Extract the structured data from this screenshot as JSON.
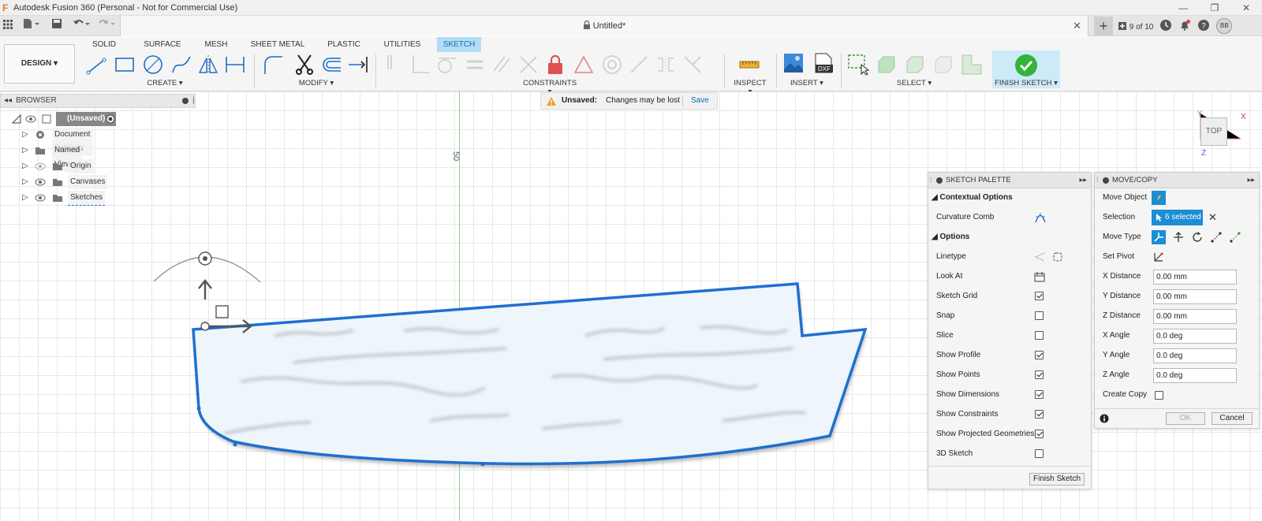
{
  "window": {
    "title": "Autodesk Fusion 360 (Personal - Not for Commercial Use)",
    "minimize": "—",
    "restore": "❐",
    "close": "✕"
  },
  "tabbar": {
    "doc_title": "Untitled*",
    "job_count": "9 of 10",
    "user_initials": "BB"
  },
  "workspace_tabs": [
    "SOLID",
    "SURFACE",
    "MESH",
    "SHEET METAL",
    "PLASTIC",
    "UTILITIES",
    "SKETCH"
  ],
  "active_workspace_tab": "SKETCH",
  "design_button": "DESIGN ▾",
  "ribbon_groups": {
    "create": "CREATE ▾",
    "modify": "MODIFY ▾",
    "constraints": "CONSTRAINTS ▾",
    "inspect": "INSPECT ▾",
    "insert": "INSERT ▾",
    "select": "SELECT ▾",
    "finish_sketch": "FINISH SKETCH ▾"
  },
  "browser": {
    "header": "BROWSER",
    "root": "(Unsaved)",
    "items": [
      "Document Settings",
      "Named Views",
      "Origin",
      "Canvases",
      "Sketches"
    ]
  },
  "notification": {
    "label": "Unsaved:",
    "message": "Changes may be lost",
    "action": "Save"
  },
  "canvas": {
    "axis_label": "50",
    "viewcube_label": "TOP",
    "axis_x": "X",
    "axis_y": "Y",
    "axis_z": "Z"
  },
  "sketch_palette": {
    "title": "SKETCH PALETTE",
    "section_contextual": "Contextual Options",
    "curvature_comb": "Curvature Comb",
    "section_options": "Options",
    "rows": [
      {
        "label": "Linetype",
        "type": "icons"
      },
      {
        "label": "Look At",
        "type": "icon"
      },
      {
        "label": "Sketch Grid",
        "checked": true
      },
      {
        "label": "Snap",
        "checked": false
      },
      {
        "label": "Slice",
        "checked": false
      },
      {
        "label": "Show Profile",
        "checked": true
      },
      {
        "label": "Show Points",
        "checked": true
      },
      {
        "label": "Show Dimensions",
        "checked": true
      },
      {
        "label": "Show Constraints",
        "checked": true
      },
      {
        "label": "Show Projected Geometries",
        "checked": true
      },
      {
        "label": "3D Sketch",
        "checked": false
      }
    ],
    "finish_button": "Finish Sketch"
  },
  "move_copy": {
    "title": "MOVE/COPY",
    "move_object": "Move Object",
    "selection": "Selection",
    "selection_value": "6 selected",
    "move_type": "Move Type",
    "set_pivot": "Set Pivot",
    "fields": [
      {
        "label": "X Distance",
        "value": "0.00 mm"
      },
      {
        "label": "Y Distance",
        "value": "0.00 mm"
      },
      {
        "label": "Z Distance",
        "value": "0.00 mm"
      },
      {
        "label": "X Angle",
        "value": "0.0 deg"
      },
      {
        "label": "Y Angle",
        "value": "0.0 deg"
      },
      {
        "label": "Z Angle",
        "value": "0.0 deg"
      }
    ],
    "create_copy": "Create Copy",
    "create_copy_checked": false,
    "ok": "OK",
    "cancel": "Cancel"
  },
  "colors": {
    "accent": "#1b8ed4",
    "sketch_line": "#1f6fd1",
    "warning": "#f0a020"
  }
}
